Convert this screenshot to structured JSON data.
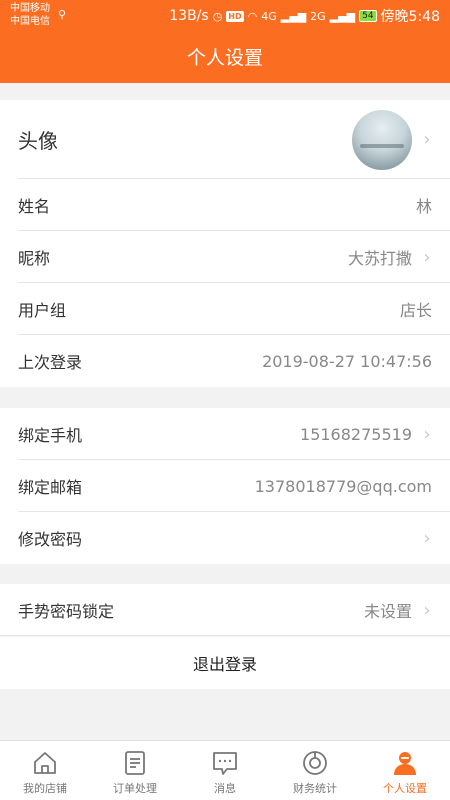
{
  "statusbar": {
    "carrier1": "中国移动",
    "carrier2": "中国电信",
    "speed": "13B/s",
    "hd": "HD",
    "net1": "4G",
    "net2": "2G",
    "battery": "54",
    "time": "傍晚5:48"
  },
  "header": {
    "title": "个人设置"
  },
  "profile": {
    "avatar_label": "头像",
    "name_label": "姓名",
    "name_value": "林",
    "nickname_label": "昵称",
    "nickname_value": "大苏打撒",
    "group_label": "用户组",
    "group_value": "店长",
    "last_login_label": "上次登录",
    "last_login_value": "2019-08-27 10:47:56"
  },
  "account": {
    "phone_label": "绑定手机",
    "phone_value": "15168275519",
    "email_label": "绑定邮箱",
    "email_value": "1378018779@qq.com",
    "password_label": "修改密码"
  },
  "security": {
    "gesture_label": "手势密码锁定",
    "gesture_value": "未设置"
  },
  "logout_label": "退出登录",
  "tabs": [
    {
      "label": "我的店铺",
      "icon": "home-icon",
      "active": false
    },
    {
      "label": "订单处理",
      "icon": "document-icon",
      "active": false
    },
    {
      "label": "消息",
      "icon": "message-icon",
      "active": false
    },
    {
      "label": "财务统计",
      "icon": "chart-icon",
      "active": false
    },
    {
      "label": "个人设置",
      "icon": "user-icon",
      "active": true
    }
  ],
  "colors": {
    "accent": "#fb6e21",
    "background": "#f2f2f2",
    "divider": "#e6e6e6"
  }
}
